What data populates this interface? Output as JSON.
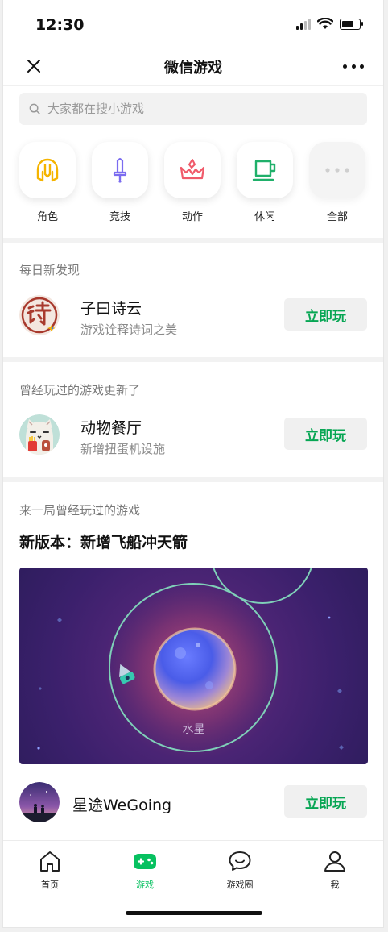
{
  "status": {
    "time": "12:30"
  },
  "nav": {
    "title": "微信游戏"
  },
  "search": {
    "placeholder": "大家都在搜小游戏"
  },
  "categories": [
    {
      "label": "角色",
      "icon": "helmet-icon",
      "color": "#f5b400"
    },
    {
      "label": "竞技",
      "icon": "sword-icon",
      "color": "#7b6cf0"
    },
    {
      "label": "动作",
      "icon": "crown-icon",
      "color": "#f05a6a"
    },
    {
      "label": "休闲",
      "icon": "cup-icon",
      "color": "#1fb06a"
    },
    {
      "label": "全部",
      "icon": "more-dots-icon",
      "color": "#cccccc"
    }
  ],
  "daily": {
    "section_title": "每日新发现",
    "game_name": "子曰诗云",
    "game_desc": "游戏诠释诗词之美",
    "button": "立即玩"
  },
  "updated": {
    "section_title": "曾经玩过的游戏更新了",
    "game_name": "动物餐厅",
    "game_desc": "新增扭蛋机设施",
    "button": "立即玩"
  },
  "replay": {
    "section_title": "来一局曾经玩过的游戏",
    "headline": "新版本：新增飞船冲天箭",
    "banner_label": "水星",
    "game_name": "星途WeGoing",
    "button": "立即玩"
  },
  "tabs": [
    {
      "label": "首页",
      "icon": "home-icon",
      "active": false
    },
    {
      "label": "游戏",
      "icon": "gamepad-icon",
      "active": true
    },
    {
      "label": "游戏圈",
      "icon": "chat-bubble-icon",
      "active": false
    },
    {
      "label": "我",
      "icon": "person-icon",
      "active": false
    }
  ],
  "colors": {
    "accent": "#07c160",
    "button_text": "#07a654"
  }
}
